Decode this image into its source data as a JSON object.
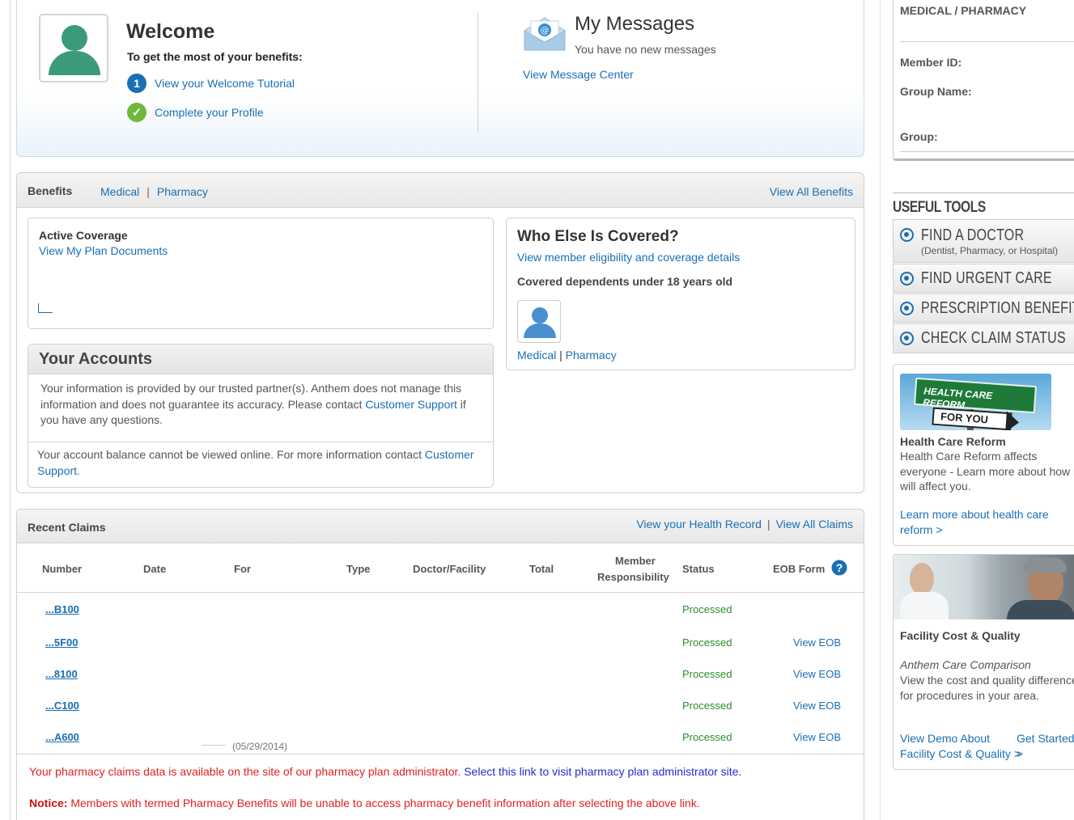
{
  "welcome": {
    "title": "Welcome",
    "subtitle": "To get the most of your benefits:",
    "tutorial_number": "1",
    "tutorial_link": "View your Welcome Tutorial",
    "profile_link": "Complete your Profile"
  },
  "messages": {
    "title": "My Messages",
    "status": "You have no new messages",
    "link": "View Message Center"
  },
  "benefits": {
    "label": "Benefits",
    "tabs": [
      "Medical",
      "Pharmacy"
    ],
    "tab_separator": "|",
    "view_all": "View All Benefits",
    "active_coverage": {
      "title": "Active Coverage",
      "link": "View My Plan Documents"
    },
    "accounts": {
      "title": "Your Accounts",
      "info_text": "Your information is provided by our trusted partner(s). Anthem does not manage this information and does not guarantee its accuracy. Please contact ",
      "info_link": "Customer Support",
      "info_suffix": " if you have any questions.",
      "balance_text": "Your account balance cannot be viewed online. For more information contact ",
      "balance_link": "Customer Support."
    },
    "who_else": {
      "title": "Who Else Is Covered?",
      "link": "View member eligibility and coverage details",
      "dependents_label": "Covered dependents under 18 years old",
      "dependent_links": [
        "Medical",
        "Pharmacy"
      ],
      "dependent_separator": "|"
    }
  },
  "claims": {
    "title": "Recent Claims",
    "health_record_link": "View your Health Record",
    "separator": "|",
    "view_all_link": "View All Claims",
    "columns": {
      "number": "Number",
      "date": "Date",
      "for": "For",
      "type": "Type",
      "doctor": "Doctor/Facility",
      "total": "Total",
      "member_resp_1": "Member",
      "member_resp_2": "Responsibility",
      "status": "Status",
      "eob": "EOB Form"
    },
    "rows": [
      {
        "number": "...B100",
        "status": "Processed",
        "eob": ""
      },
      {
        "number": "...5F00",
        "status": "Processed",
        "eob": "View EOB"
      },
      {
        "number": "...8100",
        "status": "Processed",
        "eob": "View EOB"
      },
      {
        "number": "...C100",
        "status": "Processed",
        "eob": "View EOB"
      },
      {
        "number": "...A600",
        "status": "Processed",
        "eob": "View EOB"
      }
    ],
    "partial_date": "(05/29/2014)",
    "pharmacy_note": "Your pharmacy claims data is available on the site of our pharmacy plan administrator. ",
    "pharmacy_link": "Select this link to visit pharmacy plan administrator site.",
    "notice_label": "Notice:",
    "notice_text": " Members with termed Pharmacy Benefits will be unable to access pharmacy benefit information after selecting the above link."
  },
  "member_panel": {
    "title": "MEDICAL / PHARMACY",
    "member_id_label": "Member ID:",
    "group_name_label": "Group Name:",
    "group_label": "Group:"
  },
  "useful_tools": {
    "title": "USEFUL TOOLS",
    "items": [
      {
        "name": "FIND A DOCTOR",
        "sub": "(Dentist, Pharmacy, or Hospital)"
      },
      {
        "name": "FIND URGENT CARE",
        "sub": ""
      },
      {
        "name": "PRESCRIPTION BENEFITS",
        "sub": ""
      },
      {
        "name": "CHECK CLAIM STATUS",
        "sub": ""
      }
    ]
  },
  "health_care_reform": {
    "sign_top": "HEALTH CARE REFORM",
    "sign_bottom": "FOR YOU",
    "title": "Health Care Reform",
    "text": "Health Care Reform affects everyone - Learn more about how it will affect you.",
    "link": "Learn more about health care reform >"
  },
  "facility_cost": {
    "title": "Facility Cost & Quality",
    "subtitle": "Anthem Care Comparison",
    "text": "View the cost and quality difference for procedures in your area.",
    "demo_link": "View Demo About Facility Cost & Quality >",
    "start_link": "Get Started >"
  },
  "colors": {
    "link": "#1a6fb4",
    "status_green": "#2e8b2e",
    "notice_red": "#e02020",
    "avatar_green": "#3b9a7b",
    "avatar_blue": "#4a90d0"
  }
}
